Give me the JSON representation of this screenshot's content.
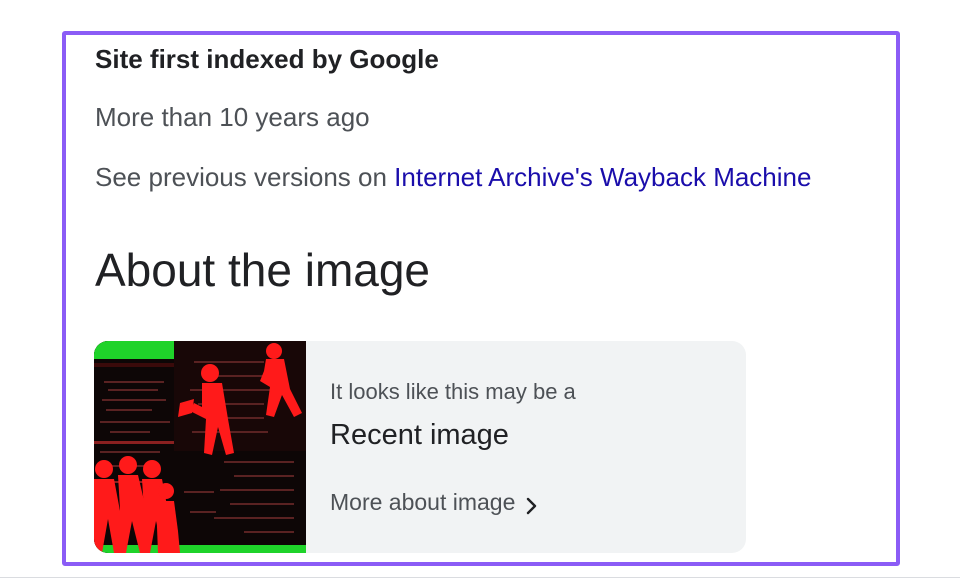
{
  "about_source": {
    "label": "Site first indexed by Google",
    "indexed_value": "More than 10 years ago",
    "wayback_prefix": "See previous versions on ",
    "wayback_link": "Internet Archive's Wayback Machine"
  },
  "about_image": {
    "heading": "About the image",
    "card": {
      "pretext": "It looks like this may be a",
      "title": "Recent image",
      "more_link": "More about image",
      "more_icon": "chevron-right-icon"
    }
  },
  "colors": {
    "highlight_border": "#8b5cf6",
    "link": "#1a0dab",
    "card_bg": "#f1f3f4",
    "thumb_red": "#ff1a1a",
    "thumb_green": "#1fd32a"
  }
}
